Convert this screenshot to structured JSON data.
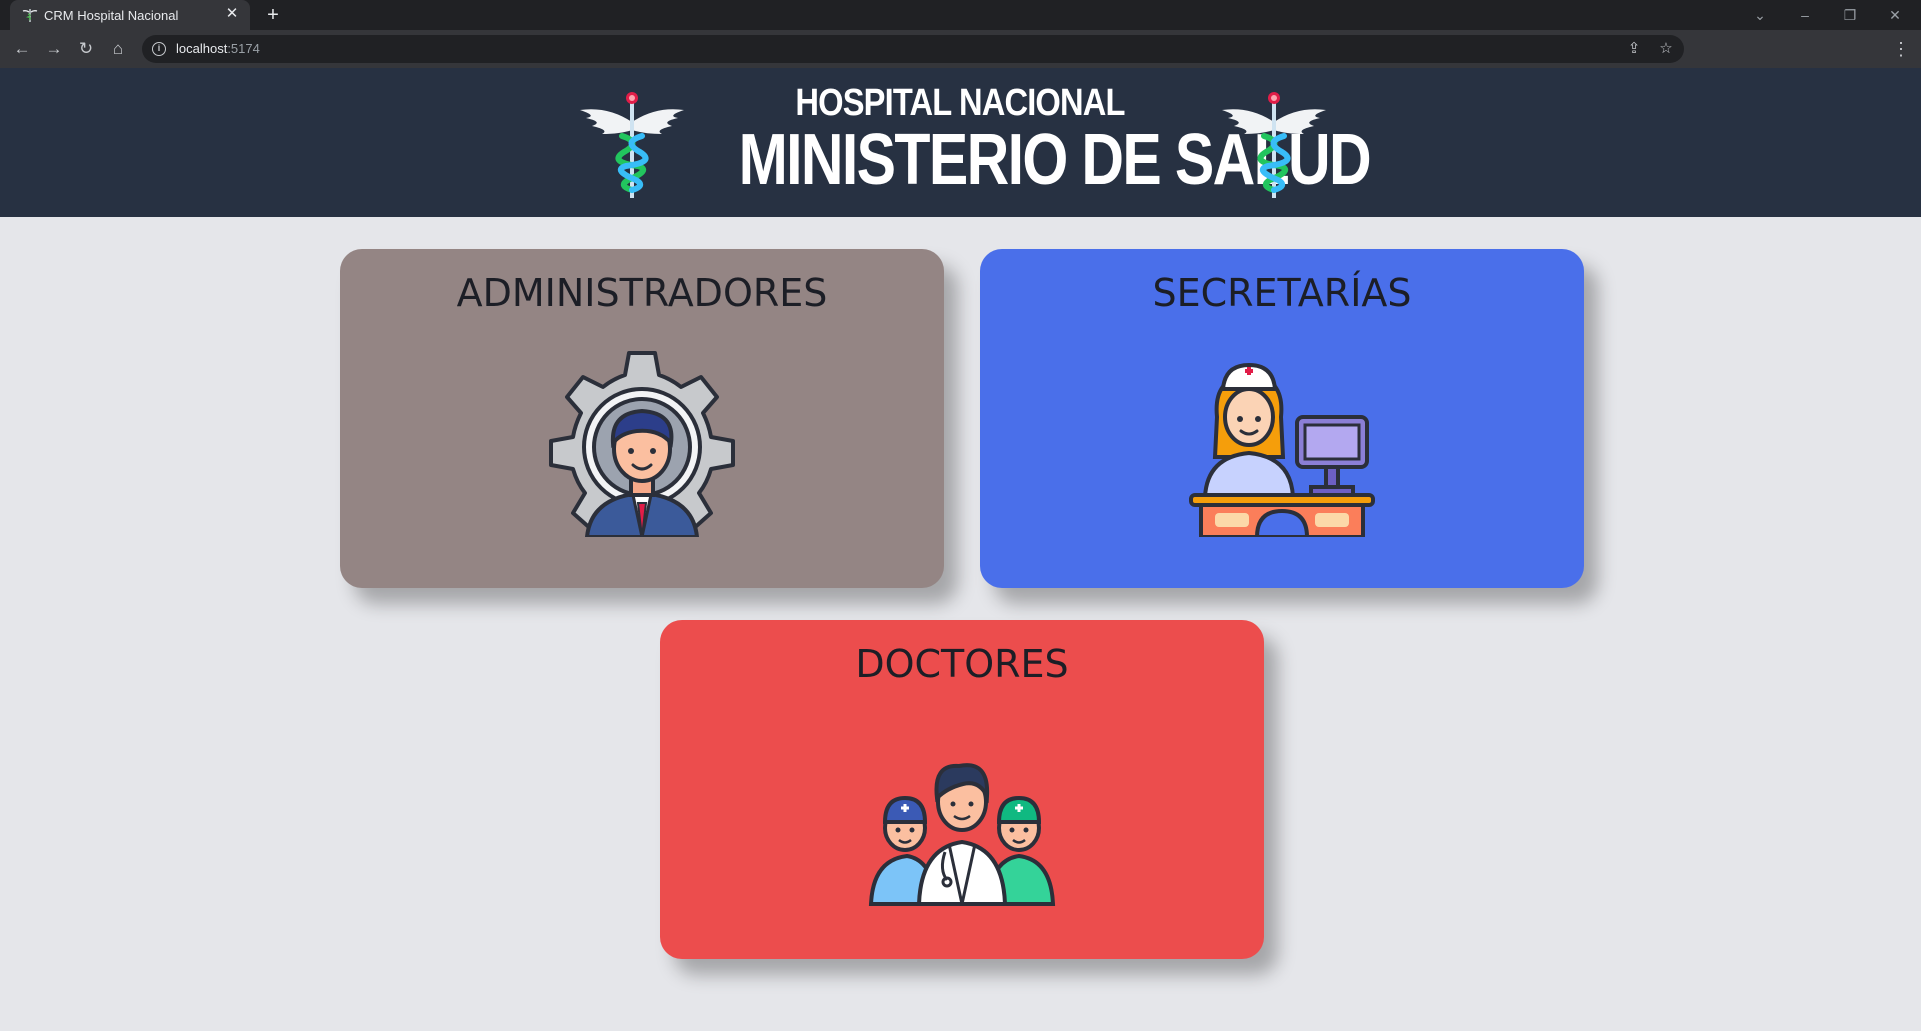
{
  "browser": {
    "tab_title": "CRM Hospital Nacional",
    "url_host": "localhost",
    "url_port": ":5174"
  },
  "header": {
    "title": "HOSPITAL NACIONAL",
    "subtitle": "MINISTERIO DE SALUD"
  },
  "cards": [
    {
      "label": "ADMINISTRADORES",
      "color": "#948584",
      "icon": "admin-gear-icon"
    },
    {
      "label": "SECRETARÍAS",
      "color": "#4a6fea",
      "icon": "nurse-desk-icon"
    },
    {
      "label": "DOCTORES",
      "color": "#ec4d4d",
      "icon": "doctors-group-icon"
    }
  ],
  "colors": {
    "header_bg": "#273142",
    "page_bg": "#e5e6ea"
  }
}
